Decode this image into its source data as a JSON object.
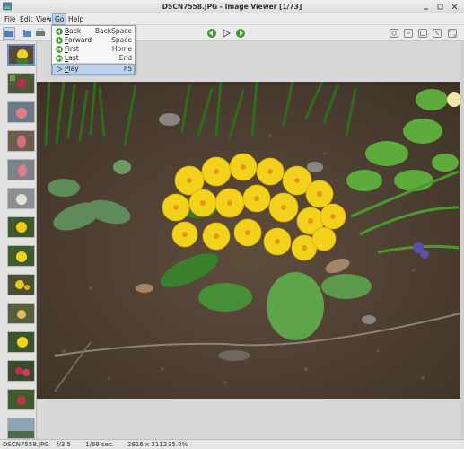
{
  "window": {
    "title": "DSCN7558.JPG - Image Viewer [1/73]"
  },
  "menubar": {
    "file": "File",
    "edit": "Edit",
    "view": "View",
    "go": "Go",
    "help": "Help"
  },
  "go_menu": {
    "items": [
      {
        "label_u": "B",
        "label_rest": "ack",
        "shortcut": "BackSpace",
        "icon": "arrow-left-icon"
      },
      {
        "label_u": "F",
        "label_rest": "orward",
        "shortcut": "Space",
        "icon": "arrow-right-icon"
      },
      {
        "label_u": "F",
        "label_rest": "irst",
        "shortcut": "Home",
        "icon": "first-icon"
      },
      {
        "label_u": "L",
        "label_rest": "ast",
        "shortcut": "End",
        "icon": "last-icon"
      },
      {
        "label_u": "P",
        "label_rest": "lay",
        "shortcut": "F5",
        "icon": "play-icon"
      }
    ]
  },
  "status": {
    "filename": "DSCN7558.JPG",
    "aperture": "f/3.5",
    "exposure": "1/68 sec.",
    "dimensions": "2816 x 2112",
    "zoom": "35.0%"
  },
  "colors": {
    "accent": "#bcd1ea",
    "accent_border": "#8aa7cc",
    "arrow_green": "#3c9a2c"
  }
}
